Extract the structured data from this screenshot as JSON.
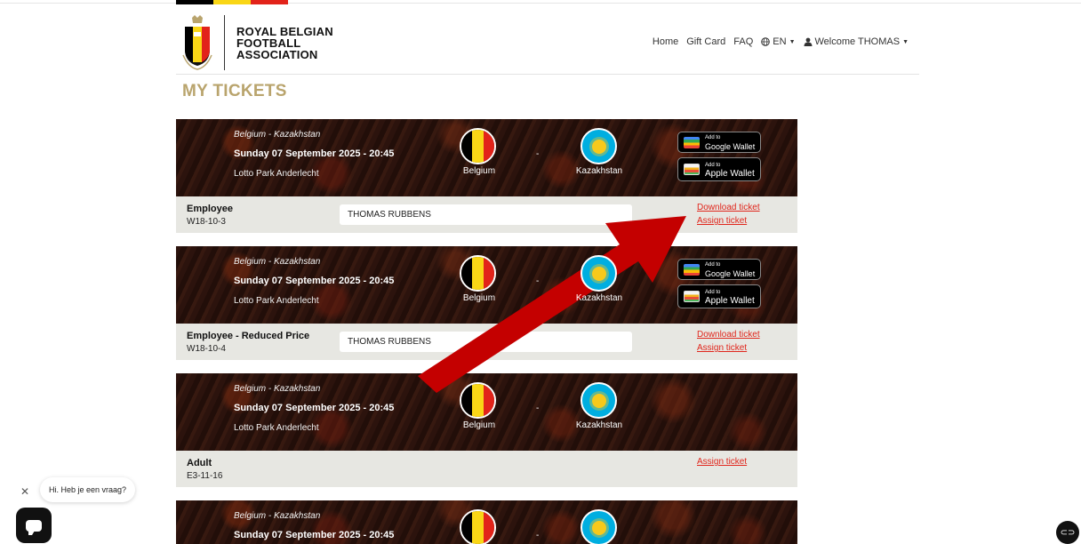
{
  "brand": {
    "line1": "ROYAL BELGIAN",
    "line2": "FOOTBALL",
    "line3": "ASSOCIATION",
    "colors": {
      "black": "#000000",
      "yellow": "#f9d616",
      "red": "#e2231a",
      "gold": "#b9a46d"
    }
  },
  "nav": {
    "home": "Home",
    "gift_card": "Gift Card",
    "faq": "FAQ",
    "language": "EN",
    "welcome": "Welcome THOMAS"
  },
  "page": {
    "title": "MY TICKETS"
  },
  "tickets": [
    {
      "match_name": "Belgium - Kazakhstan",
      "match_date": "Sunday 07 September 2025 - 20:45",
      "venue": "Lotto Park Anderlecht",
      "home_team": "Belgium",
      "away_team": "Kazakhstan",
      "vs": "-",
      "google_wallet_small": "Add to",
      "google_wallet": "Google Wallet",
      "apple_wallet_small": "Add to",
      "apple_wallet": "Apple Wallet",
      "ticket_type": "Employee",
      "seat": "W18-10-3",
      "holder": "THOMAS RUBBENS",
      "download_label": "Download ticket",
      "assign_label": "Assign ticket"
    },
    {
      "match_name": "Belgium - Kazakhstan",
      "match_date": "Sunday 07 September 2025 - 20:45",
      "venue": "Lotto Park Anderlecht",
      "home_team": "Belgium",
      "away_team": "Kazakhstan",
      "vs": "-",
      "google_wallet_small": "Add to",
      "google_wallet": "Google Wallet",
      "apple_wallet_small": "Add to",
      "apple_wallet": "Apple Wallet",
      "ticket_type": "Employee - Reduced Price",
      "seat": "W18-10-4",
      "holder": "THOMAS RUBBENS",
      "download_label": "Download ticket",
      "assign_label": "Assign ticket"
    },
    {
      "match_name": "Belgium - Kazakhstan",
      "match_date": "Sunday 07 September 2025 - 20:45",
      "venue": "Lotto Park Anderlecht",
      "home_team": "Belgium",
      "away_team": "Kazakhstan",
      "vs": "-",
      "ticket_type": "Adult",
      "seat": "E3-11-16",
      "assign_label": "Assign ticket"
    },
    {
      "match_name": "Belgium - Kazakhstan",
      "match_date": "Sunday 07 September 2025 - 20:45",
      "vs": "-"
    }
  ],
  "chat": {
    "greeting": "Hi. Heb je een vraag?"
  },
  "annotation": {
    "arrow_color": "#c40000"
  },
  "icons": {
    "logo": "rbfa-crest-icon",
    "globe": "globe-icon",
    "user": "user-icon",
    "caret": "caret-down-icon",
    "close": "close-icon",
    "chat": "chat-icon",
    "corner": "accessibility-icon"
  }
}
